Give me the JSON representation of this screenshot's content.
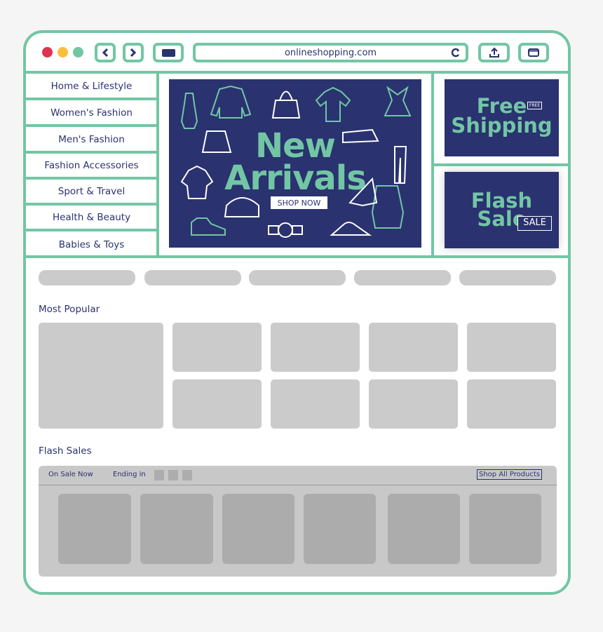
{
  "browser": {
    "url": "onlineshopping.com",
    "window_dots": [
      "#e0334f",
      "#fbbf3a",
      "#72c6a4"
    ],
    "buttons": [
      "back-icon",
      "forward-icon",
      "tab-icon",
      "reload-icon",
      "share-icon",
      "window-icon"
    ]
  },
  "sidebar": {
    "items": [
      {
        "label": "Home & Lifestyle"
      },
      {
        "label": "Women's Fashion"
      },
      {
        "label": "Men's Fashion"
      },
      {
        "label": "Fashion Accessories"
      },
      {
        "label": "Sport & Travel"
      },
      {
        "label": "Health & Beauty"
      },
      {
        "label": "Babies & Toys"
      }
    ]
  },
  "hero": {
    "title_line1": "New",
    "title_line2": "Arrivals",
    "cta": "SHOP NOW"
  },
  "promos": {
    "free_shipping": {
      "line1": "Free",
      "line2": "Shipping",
      "badge": "FREE"
    },
    "flash_sale": {
      "line1": "Flash",
      "line2": "Sale",
      "tag": "SALE"
    }
  },
  "sections": {
    "most_popular": "Most Popular",
    "flash_sales": "Flash Sales",
    "on_sale_now": "On Sale Now",
    "ending_in": "Ending in",
    "shop_all": "Shop All Products"
  },
  "colors": {
    "accent": "#72c6a4",
    "navy": "#2a3270",
    "placeholder": "#cbcbcb"
  }
}
